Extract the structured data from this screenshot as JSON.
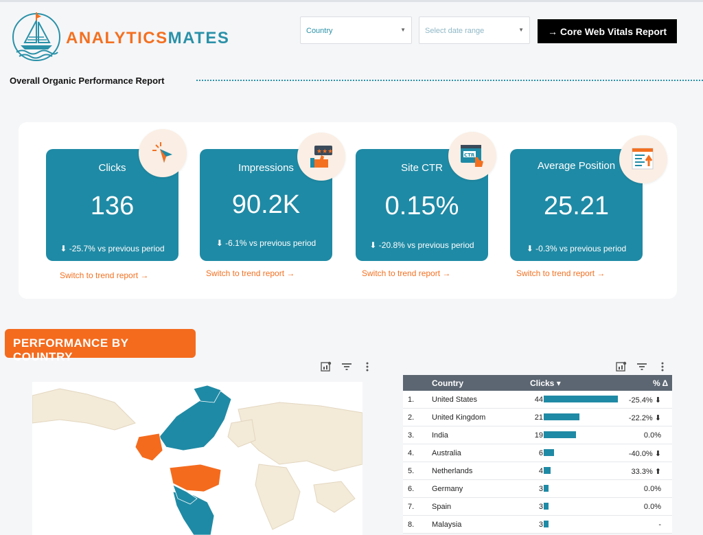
{
  "brand": {
    "part1": "ANALYTICS",
    "part2": "MATES"
  },
  "filters": {
    "country_label": "Country",
    "date_label": "Select date range",
    "cwv_button": "→ Core Web Vitals Report"
  },
  "report_title": "Overall Organic Performance Report",
  "kpis": [
    {
      "name": "Clicks",
      "value": "136",
      "delta": "⬇ -25.7% vs previous period",
      "link": "Switch to trend report →"
    },
    {
      "name": "Impressions",
      "value": "90.2K",
      "delta": "⬇ -6.1% vs previous period",
      "link": "Switch to trend report →"
    },
    {
      "name": "Site CTR",
      "value": "0.15%",
      "delta": "⬇ -20.8% vs previous period",
      "link": "Switch to trend report →"
    },
    {
      "name": "Average Position",
      "value": "25.21",
      "delta": "⬇ -0.3% vs previous period",
      "link": "Switch to trend report →"
    }
  ],
  "section_title": "PERFORMANCE BY COUNTRY",
  "table": {
    "headers": {
      "country": "Country",
      "clicks": "Clicks ▾",
      "pct": "% Δ"
    },
    "rows": [
      {
        "rank": "1.",
        "country": "United States",
        "clicks": "44",
        "clicks_value": 44,
        "pct": "-25.4% ⬇"
      },
      {
        "rank": "2.",
        "country": "United Kingdom",
        "clicks": "21",
        "clicks_value": 21,
        "pct": "-22.2% ⬇"
      },
      {
        "rank": "3.",
        "country": "India",
        "clicks": "19",
        "clicks_value": 19,
        "pct": "0.0%"
      },
      {
        "rank": "4.",
        "country": "Australia",
        "clicks": "6",
        "clicks_value": 6,
        "pct": "-40.0% ⬇"
      },
      {
        "rank": "5.",
        "country": "Netherlands",
        "clicks": "4",
        "clicks_value": 4,
        "pct": "33.3% ⬆"
      },
      {
        "rank": "6.",
        "country": "Germany",
        "clicks": "3",
        "clicks_value": 3,
        "pct": "0.0%"
      },
      {
        "rank": "7.",
        "country": "Spain",
        "clicks": "3",
        "clicks_value": 3,
        "pct": "0.0%"
      },
      {
        "rank": "8.",
        "country": "Malaysia",
        "clicks": "3",
        "clicks_value": 3,
        "pct": "-"
      }
    ]
  },
  "colors": {
    "accent": "#1f8aa5",
    "orange": "#f37021"
  }
}
